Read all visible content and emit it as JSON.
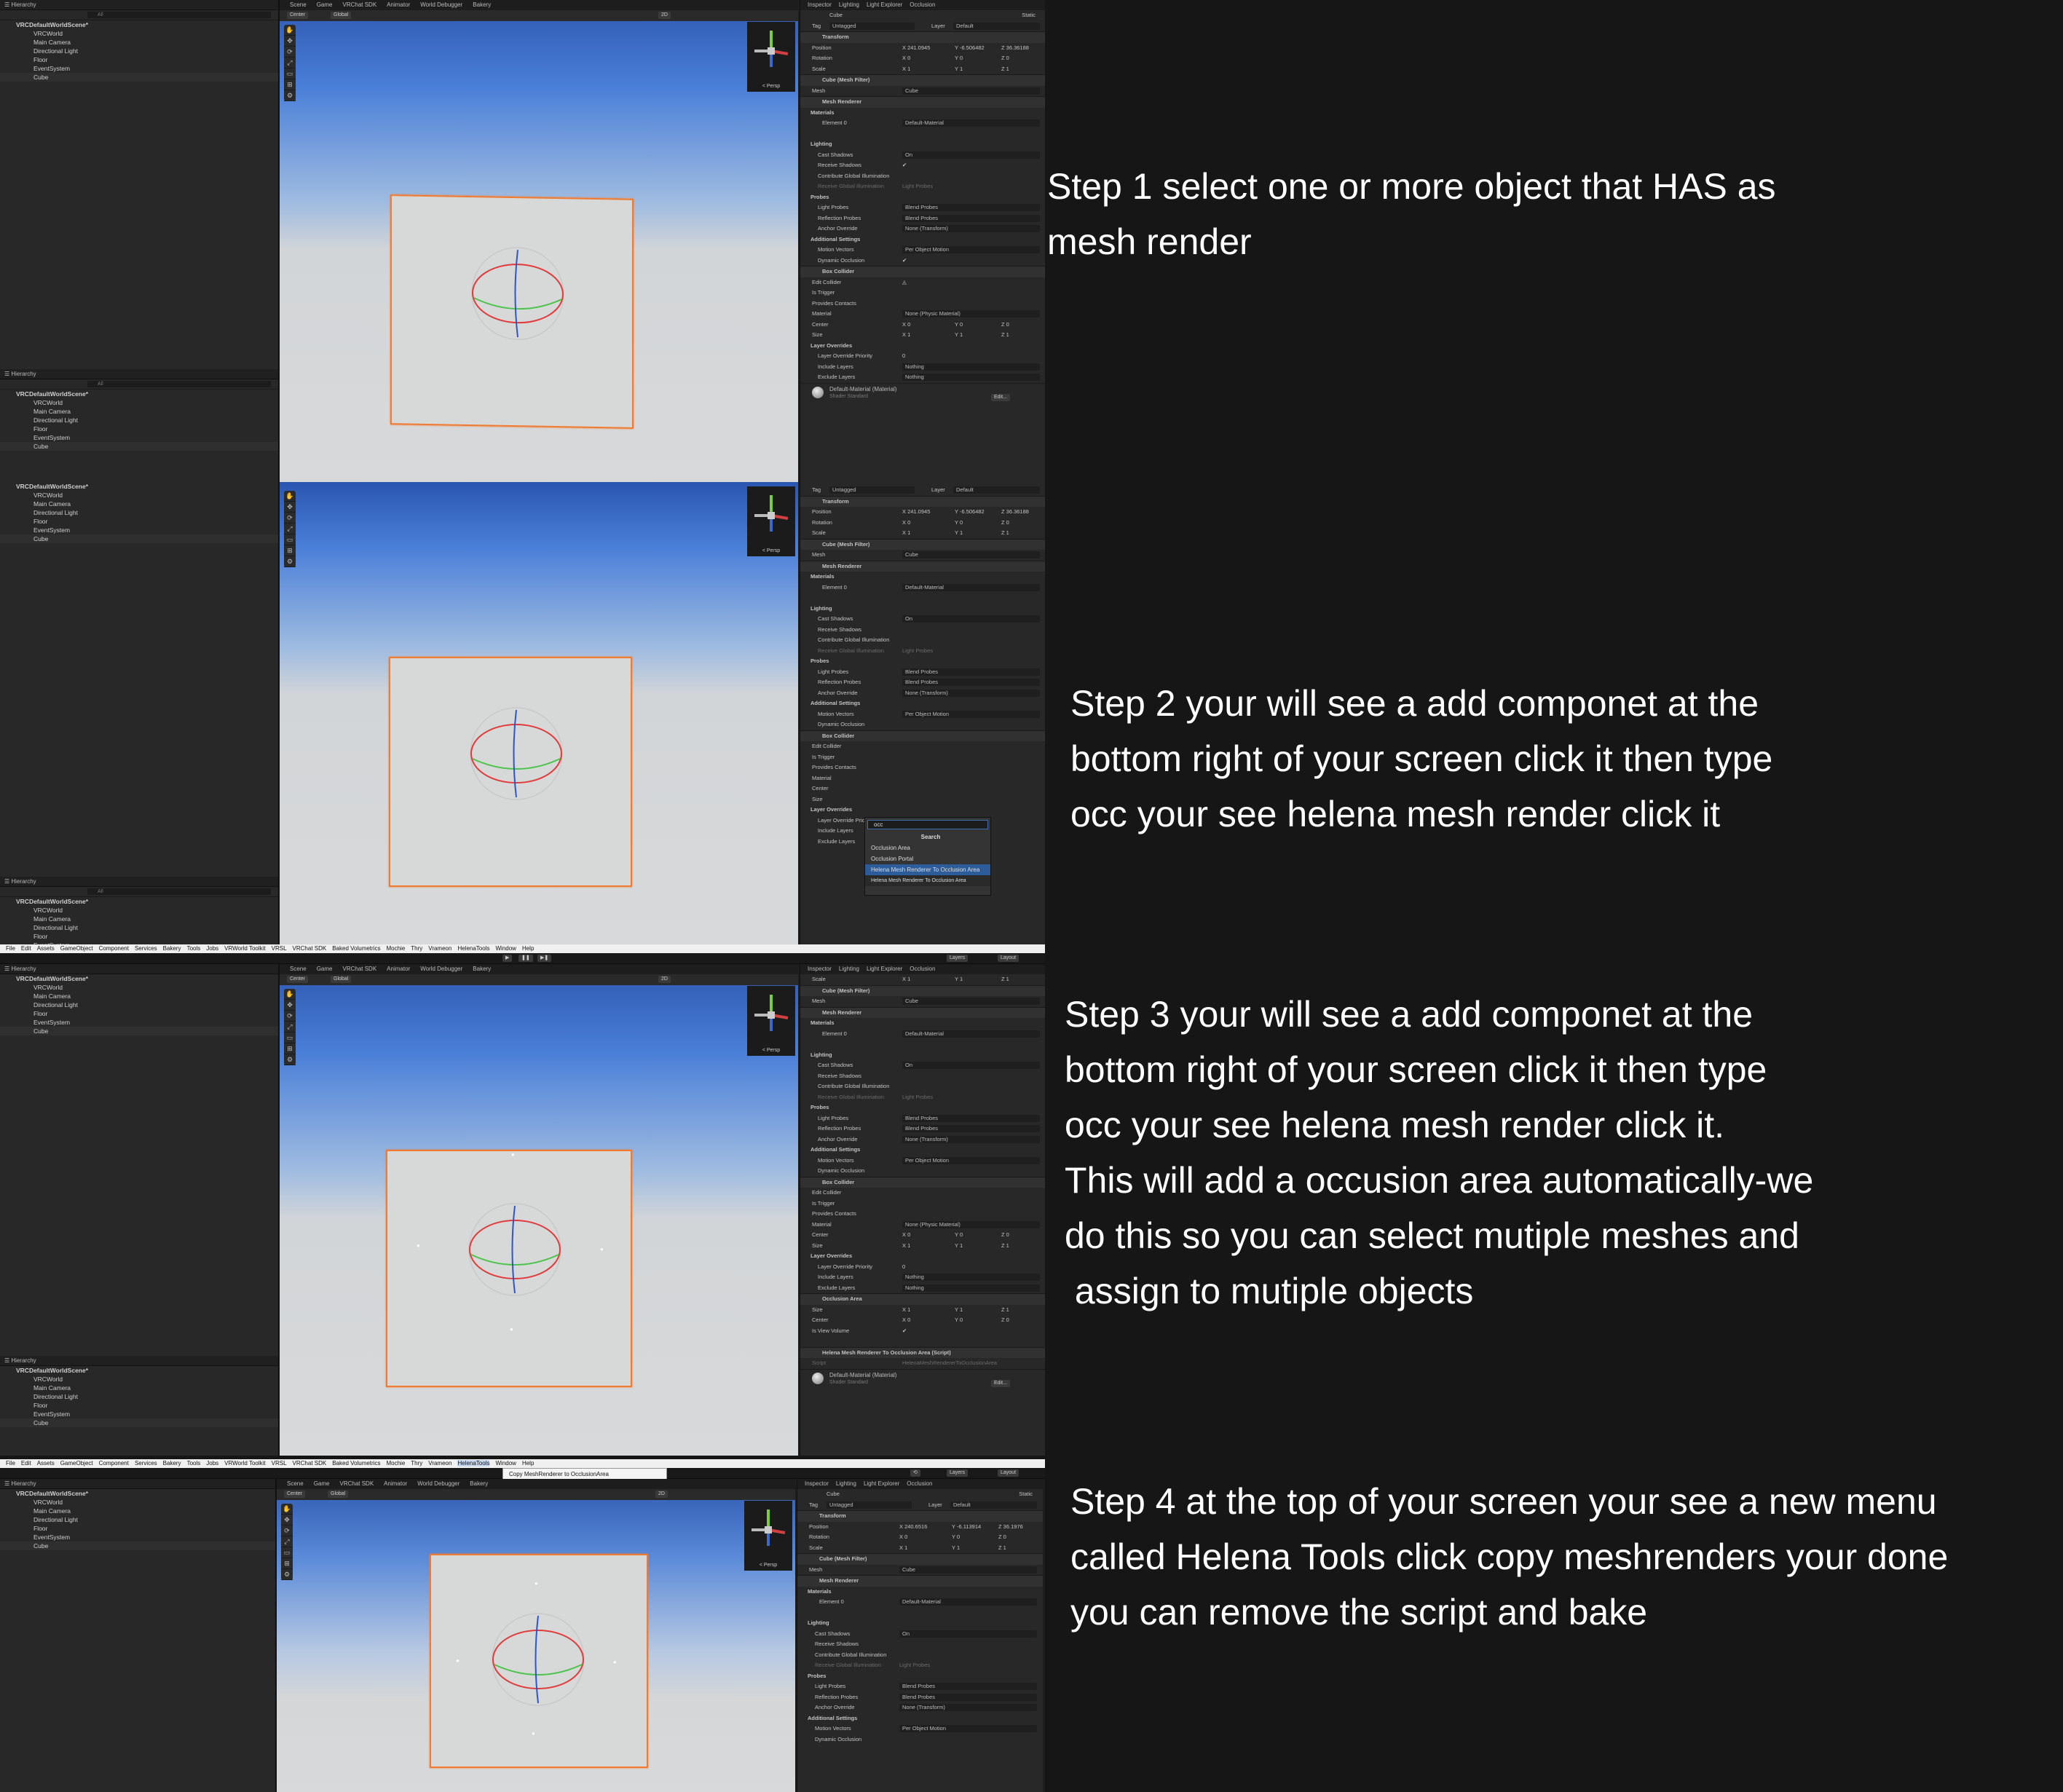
{
  "menu": {
    "items": [
      "File",
      "Edit",
      "Assets",
      "GameObject",
      "Component",
      "Services",
      "Bakery",
      "Tools",
      "Jobs",
      "VRWorld Toolkit",
      "VRSL",
      "VRChat SDK",
      "Baked Volumetrics",
      "Mochie",
      "Thry",
      "Vrameon",
      "HelenaTools",
      "Window",
      "Help"
    ],
    "dropdown_item": "Copy MeshRenderer to OcclusionArea",
    "layers_label": "Layers",
    "layout_label": "Layout"
  },
  "scene_tabs": [
    "Scene",
    "Game",
    "VRChat SDK",
    "Animator",
    "World Debugger",
    "Bakery"
  ],
  "inspector_tabs": [
    "Inspector",
    "Lighting",
    "Light Explorer",
    "Occlusion"
  ],
  "scene_tools": {
    "center": "Center",
    "global": "Global",
    "mode2d": "2D",
    "persp": "< Persp"
  },
  "hierarchy": {
    "title": "Hierarchy",
    "search_placeholder": "All",
    "root": "VRCDefaultWorldScene*",
    "children": [
      "VRCWorld",
      "Main Camera",
      "Directional Light",
      "Floor",
      "EventSystem",
      "Cube"
    ]
  },
  "inspector": {
    "object_name": "Cube",
    "static_label": "Static",
    "tag_label": "Tag",
    "tag_value": "Untagged",
    "layer_label": "Layer",
    "layer_value": "Default",
    "transform": "Transform",
    "position_label": "Position",
    "position": [
      "X 241.0945",
      "Y -6.506482",
      "Z 36.36188"
    ],
    "position_step4": [
      "X 240.6516",
      "Y -6.113914",
      "Z 36.1976"
    ],
    "rotation_label": "Rotation",
    "rotation": [
      "X 0",
      "Y 0",
      "Z 0"
    ],
    "scale_label": "Scale",
    "scale": [
      "X 1",
      "Y 1",
      "Z 1"
    ],
    "mesh_filter": "Cube (Mesh Filter)",
    "mesh_label": "Mesh",
    "mesh_value": "Cube",
    "mesh_renderer": "Mesh Renderer",
    "materials": "Materials",
    "element0": "Element 0",
    "element0_value": "Default-Material",
    "lighting": "Lighting",
    "cast_shadows": "Cast Shadows",
    "cast_shadows_value": "On",
    "receive_shadows": "Receive Shadows",
    "contribute_gi": "Contribute Global Illumination",
    "receive_gi": "Receive Global Illumination",
    "receive_gi_value": "Light Probes",
    "probes": "Probes",
    "light_probes": "Light Probes",
    "light_probes_value": "Blend Probes",
    "reflection_probes": "Reflection Probes",
    "reflection_probes_value": "Blend Probes",
    "anchor_override": "Anchor Override",
    "anchor_override_value": "None (Transform)",
    "additional": "Additional Settings",
    "motion_vectors": "Motion Vectors",
    "motion_vectors_value": "Per Object Motion",
    "dynamic_occlusion": "Dynamic Occlusion",
    "box_collider": "Box Collider",
    "edit_collider": "Edit Collider",
    "is_trigger": "Is Trigger",
    "provides_contacts": "Provides Contacts",
    "material_label": "Material",
    "material_value": "None (Physic Material)",
    "center_label": "Center",
    "center": [
      "X 0",
      "Y 0",
      "Z 0"
    ],
    "size_label": "Size",
    "size": [
      "X 1",
      "Y 1",
      "Z 1"
    ],
    "layer_overrides": "Layer Overrides",
    "layer_override_priority": "Layer Override Priority",
    "priority_value": "0",
    "include_layers": "Include Layers",
    "include_value": "Nothing",
    "exclude_layers": "Exclude Layers",
    "exclude_value": "Nothing",
    "occlusion_area": "Occlusion Area",
    "is_view_volume": "Is View Volume",
    "helena_script": "Helena Mesh Renderer To Occlusion Area (Script)",
    "script_label": "Script",
    "script_value": "HelenaMeshRendererToOcclusionArea",
    "material_footer": "Default-Material (Material)",
    "shader_label": "Shader",
    "shader_value": "Standard",
    "edit_button": "Edit..."
  },
  "search_popup": {
    "query": "occ",
    "title": "Search",
    "items": [
      "Occlusion Area",
      "Occlusion Portal",
      "Helena Mesh Renderer To Occlusion Area"
    ],
    "tooltip": "Helena Mesh Renderer To Occlusion Area"
  },
  "captions": {
    "step1": "Step 1 select one or more object that HAS as\nmesh render",
    "step2": "Step 2 your will see a add componet at the\nbottom right of your screen click it then type\nocc your see helena mesh render click it",
    "step3": "Step 3 your will see a add componet at the\nbottom right of your screen click it then type\nocc your see helena mesh render click it.\nThis will add a occusion area automatically-we\ndo this so you can select mutiple meshes and\n assign to mutiple objects",
    "step4": "Step 4 at the top of your screen your see a new menu\ncalled Helena Tools click copy meshrenders your done\nyou can remove the script and bake"
  },
  "colors": {
    "selection_outline": "#f07a30",
    "sky": "#4a7fd8",
    "ground": "#d8d9da",
    "editor_bg": "#282828",
    "page_bg": "#161616",
    "highlight": "#2c5d9a"
  }
}
